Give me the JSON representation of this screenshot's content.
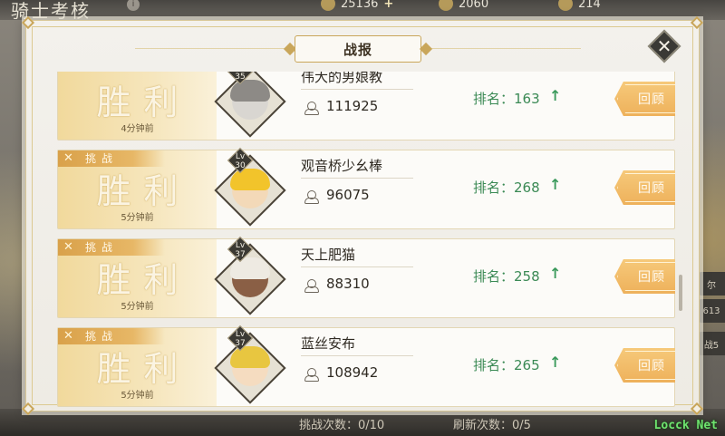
{
  "background": {
    "title": "骑士考核",
    "resources": [
      {
        "icon": "diamond-icon",
        "value": "25136"
      },
      {
        "icon": "coin-icon",
        "value": "2060"
      },
      {
        "icon": "medal-icon",
        "value": "214"
      }
    ],
    "side_labels": [
      "尔",
      "613",
      "战5"
    ],
    "bottom_stats": {
      "challenge_count": "挑战次数：0/10",
      "refresh_count": "刷新次数：0/5"
    },
    "watermark": "Locck Net"
  },
  "modal": {
    "title": "战报",
    "close_icon": "close-icon",
    "records": [
      {
        "result": "胜利",
        "time": "4分钟前",
        "challenge": false,
        "level_label": "Lv",
        "level": "35",
        "name": "伟大的男娘教",
        "power": "111925",
        "rank_label": "排名：",
        "rank": "163",
        "rank_change": "up",
        "review_label": "回顾"
      },
      {
        "result": "胜利",
        "time": "5分钟前",
        "challenge": true,
        "challenge_label": "挑战",
        "level_label": "Lv",
        "level": "30",
        "name": "观音桥少幺棒",
        "power": "96075",
        "rank_label": "排名：",
        "rank": "268",
        "rank_change": "up",
        "review_label": "回顾"
      },
      {
        "result": "胜利",
        "time": "5分钟前",
        "challenge": true,
        "challenge_label": "挑战",
        "level_label": "Lv",
        "level": "37",
        "name": "天上肥猫",
        "power": "88310",
        "rank_label": "排名：",
        "rank": "258",
        "rank_change": "up",
        "review_label": "回顾"
      },
      {
        "result": "胜利",
        "time": "5分钟前",
        "challenge": true,
        "challenge_label": "挑战",
        "level_label": "Lv",
        "level": "37",
        "name": "蓝丝安布",
        "power": "108942",
        "rank_label": "排名：",
        "rank": "265",
        "rank_change": "up",
        "review_label": "回顾"
      }
    ]
  },
  "colors": {
    "rank_green": "#3b8a55",
    "button_gold": "#eeb15b",
    "challenge_orange": "#d9a14a"
  }
}
